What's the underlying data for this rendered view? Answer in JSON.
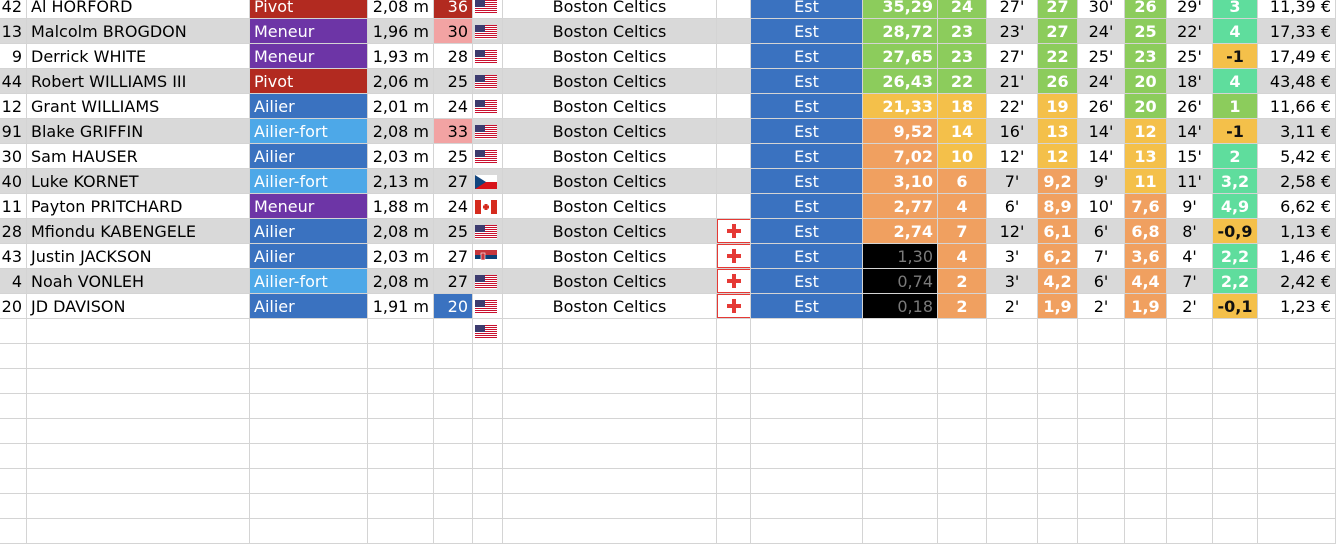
{
  "roster": [
    {
      "num": "42",
      "name": "Al HORFORD",
      "pos": "Pivot",
      "height": "2,08 m",
      "age": "36",
      "flag": "us",
      "team": "Boston Celtics",
      "injured": false,
      "conf": "Est",
      "eval": "35,29",
      "c1": "24",
      "c2": "27'",
      "c3": "27",
      "c4": "30'",
      "c5": "26",
      "c6": "29'",
      "diff": "3",
      "salary": "11,39 €"
    },
    {
      "num": "13",
      "name": "Malcolm BROGDON",
      "pos": "Meneur",
      "height": "1,96 m",
      "age": "30",
      "flag": "us",
      "team": "Boston Celtics",
      "injured": false,
      "conf": "Est",
      "eval": "28,72",
      "c1": "23",
      "c2": "23'",
      "c3": "27",
      "c4": "24'",
      "c5": "25",
      "c6": "22'",
      "diff": "4",
      "salary": "17,33 €"
    },
    {
      "num": "9",
      "name": "Derrick WHITE",
      "pos": "Meneur",
      "height": "1,93 m",
      "age": "28",
      "flag": "us",
      "team": "Boston Celtics",
      "injured": false,
      "conf": "Est",
      "eval": "27,65",
      "c1": "23",
      "c2": "27'",
      "c3": "22",
      "c4": "25'",
      "c5": "23",
      "c6": "25'",
      "diff": "-1",
      "salary": "17,49 €"
    },
    {
      "num": "44",
      "name": "Robert WILLIAMS III",
      "pos": "Pivot",
      "height": "2,06 m",
      "age": "25",
      "flag": "us",
      "team": "Boston Celtics",
      "injured": false,
      "conf": "Est",
      "eval": "26,43",
      "c1": "22",
      "c2": "21'",
      "c3": "26",
      "c4": "24'",
      "c5": "20",
      "c6": "18'",
      "diff": "4",
      "salary": "43,48 €"
    },
    {
      "num": "12",
      "name": "Grant WILLIAMS",
      "pos": "Ailier",
      "height": "2,01 m",
      "age": "24",
      "flag": "us",
      "team": "Boston Celtics",
      "injured": false,
      "conf": "Est",
      "eval": "21,33",
      "c1": "18",
      "c2": "22'",
      "c3": "19",
      "c4": "26'",
      "c5": "20",
      "c6": "26'",
      "diff": "1",
      "salary": "11,66 €"
    },
    {
      "num": "91",
      "name": "Blake GRIFFIN",
      "pos": "Ailier-fort",
      "height": "2,08 m",
      "age": "33",
      "flag": "us",
      "team": "Boston Celtics",
      "injured": false,
      "conf": "Est",
      "eval": "9,52",
      "c1": "14",
      "c2": "16'",
      "c3": "13",
      "c4": "14'",
      "c5": "12",
      "c6": "14'",
      "diff": "-1",
      "salary": "3,11 €"
    },
    {
      "num": "30",
      "name": "Sam HAUSER",
      "pos": "Ailier",
      "height": "2,03 m",
      "age": "25",
      "flag": "us",
      "team": "Boston Celtics",
      "injured": false,
      "conf": "Est",
      "eval": "7,02",
      "c1": "10",
      "c2": "12'",
      "c3": "12",
      "c4": "14'",
      "c5": "13",
      "c6": "15'",
      "diff": "2",
      "salary": "5,42 €"
    },
    {
      "num": "40",
      "name": "Luke KORNET",
      "pos": "Ailier-fort",
      "height": "2,13 m",
      "age": "27",
      "flag": "cz",
      "team": "Boston Celtics",
      "injured": false,
      "conf": "Est",
      "eval": "3,10",
      "c1": "6",
      "c2": "7'",
      "c3": "9,2",
      "c4": "9'",
      "c5": "11",
      "c6": "11'",
      "diff": "3,2",
      "salary": "2,58 €"
    },
    {
      "num": "11",
      "name": "Payton PRITCHARD",
      "pos": "Meneur",
      "height": "1,88 m",
      "age": "24",
      "flag": "ca",
      "team": "Boston Celtics",
      "injured": false,
      "conf": "Est",
      "eval": "2,77",
      "c1": "4",
      "c2": "6'",
      "c3": "8,9",
      "c4": "10'",
      "c5": "7,6",
      "c6": "9'",
      "diff": "4,9",
      "salary": "6,62 €"
    },
    {
      "num": "28",
      "name": "Mfiondu KABENGELE",
      "pos": "Ailier",
      "height": "2,08 m",
      "age": "25",
      "flag": "us",
      "team": "Boston Celtics",
      "injured": true,
      "conf": "Est",
      "eval": "2,74",
      "c1": "7",
      "c2": "12'",
      "c3": "6,1",
      "c4": "6'",
      "c5": "6,8",
      "c6": "8'",
      "diff": "-0,9",
      "salary": "1,13 €"
    },
    {
      "num": "43",
      "name": "Justin JACKSON",
      "pos": "Ailier",
      "height": "2,03 m",
      "age": "27",
      "flag": "rs",
      "team": "Boston Celtics",
      "injured": true,
      "conf": "Est",
      "eval": "1,30",
      "c1": "4",
      "c2": "3'",
      "c3": "6,2",
      "c4": "7'",
      "c5": "3,6",
      "c6": "4'",
      "diff": "2,2",
      "salary": "1,46 €"
    },
    {
      "num": "4",
      "name": "Noah VONLEH",
      "pos": "Ailier-fort",
      "height": "2,08 m",
      "age": "27",
      "flag": "us",
      "team": "Boston Celtics",
      "injured": true,
      "conf": "Est",
      "eval": "0,74",
      "c1": "2",
      "c2": "3'",
      "c3": "4,2",
      "c4": "6'",
      "c5": "4,4",
      "c6": "7'",
      "diff": "2,2",
      "salary": "2,42 €"
    },
    {
      "num": "20",
      "name": "JD DAVISON",
      "pos": "Ailier",
      "height": "1,91 m",
      "age": "20",
      "flag": "us",
      "team": "Boston Celtics",
      "injured": true,
      "conf": "Est",
      "eval": "0,18",
      "c1": "2",
      "c2": "2'",
      "c3": "1,9",
      "c4": "2'",
      "c5": "1,9",
      "c6": "2'",
      "diff": "-0,1",
      "salary": "1,23 €"
    }
  ],
  "trailing_flags": [
    "us"
  ],
  "colors": {
    "pos_pivot": "#b22a20",
    "pos_meneur": "#6d35a6",
    "pos_ailier": "#3a72c0",
    "pos_ailier_fort": "#4da8e8",
    "conf_est": "#3a72c0",
    "age_high": "#b22a20",
    "age_mid": "#f2a3a3",
    "age_low": "#3a72c0",
    "green": "#8ccc5c",
    "yellow": "#f4c04a",
    "orange": "#f0a060",
    "black": "#000000",
    "teal": "#5fdd9d",
    "zebra": "#d9d9d9",
    "grid": "#d4d4d4",
    "cross": "#e53935"
  }
}
